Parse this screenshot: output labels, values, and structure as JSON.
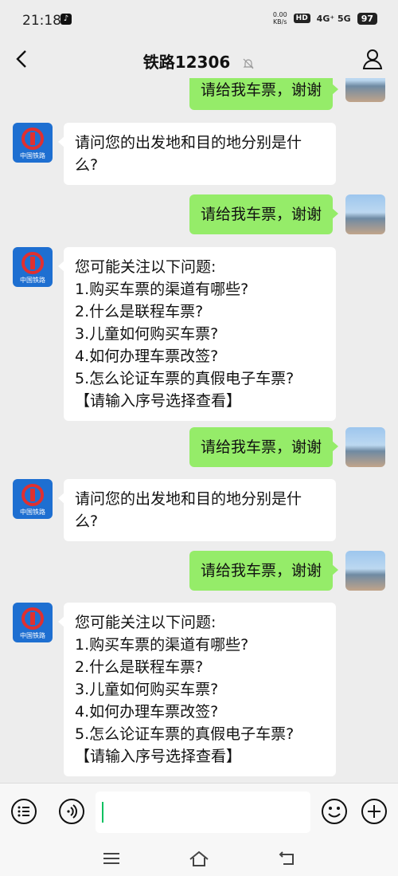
{
  "status_bar": {
    "time": "21:18",
    "speed_value": "0.00",
    "speed_unit": "KB/s",
    "hd": "HD",
    "network": "4G⁺ 5G",
    "battery": "97"
  },
  "header": {
    "title": "铁路12306",
    "icons": [
      "back-icon",
      "mute-icon",
      "person-icon"
    ]
  },
  "messages": [
    {
      "from": "user",
      "text": "请给我车票，谢谢"
    },
    {
      "from": "bot",
      "text": "请问您的出发地和目的地分别是什\n么?"
    },
    {
      "from": "user",
      "text": "请给我车票，谢谢"
    },
    {
      "from": "bot",
      "text": "您可能关注以下问题:\n1.购买车票的渠道有哪些?\n2.什么是联程车票?\n3.儿童如何购买车票?\n4.如何办理车票改签?\n5.怎么论证车票的真假电子车票?\n【请输入序号选择查看】"
    },
    {
      "from": "user",
      "text": "请给我车票，谢谢"
    },
    {
      "from": "bot",
      "text": "请问您的出发地和目的地分别是什\n么?"
    },
    {
      "from": "user",
      "text": "请给我车票，谢谢"
    },
    {
      "from": "bot",
      "text": "您可能关注以下问题:\n1.购买车票的渠道有哪些?\n2.什么是联程车票?\n3.儿童如何购买车票?\n4.如何办理车票改签?\n5.怎么论证车票的真假电子车票?\n【请输入序号选择查看】"
    }
  ],
  "bot_avatar_label": "中国铁路",
  "input": {
    "value": ""
  },
  "colors": {
    "user_bubble": "#95ec69",
    "bot_bubble": "#ffffff",
    "background": "#ededed",
    "bot_avatar": "#1e6fd1"
  }
}
